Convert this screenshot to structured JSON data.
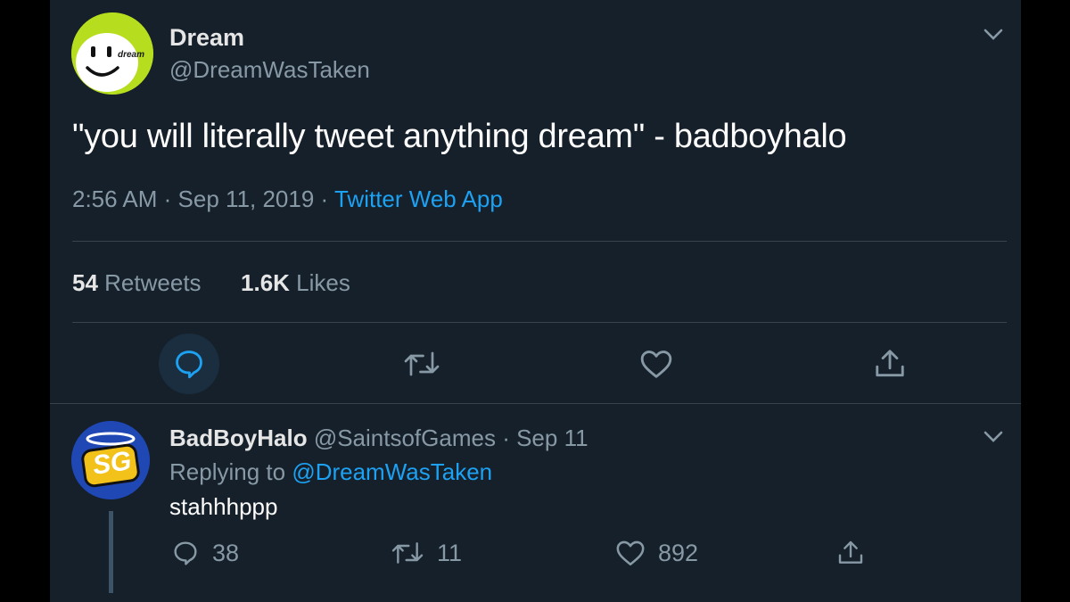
{
  "tweet": {
    "author_name": "Dream",
    "author_handle": "@DreamWasTaken",
    "avatar_text": "dream",
    "text": "\"you will literally tweet anything dream\" - badboyhalo",
    "time": "2:56 AM",
    "sep1": "·",
    "date": "Sep 11, 2019",
    "sep2": "·",
    "source": "Twitter Web App",
    "retweets_count": "54",
    "retweets_label": "Retweets",
    "likes_count": "1.6K",
    "likes_label": "Likes"
  },
  "reply": {
    "author_name": "BadBoyHalo",
    "author_handle": "@SaintsofGames",
    "sep": "·",
    "date": "Sep 11",
    "replying_prefix": "Replying to",
    "replying_to": "@DreamWasTaken",
    "avatar_text": "SG",
    "text": "stahhhppp",
    "reply_count": "38",
    "retweet_count": "11",
    "like_count": "892"
  },
  "colors": {
    "background": "#15202b",
    "accent": "#1da1f2",
    "muted": "#8899a6",
    "divider": "#38444d",
    "avatar_green": "#b6dd1e"
  },
  "icons": [
    "chevron-down-icon",
    "reply-icon",
    "retweet-icon",
    "like-icon",
    "share-icon"
  ]
}
